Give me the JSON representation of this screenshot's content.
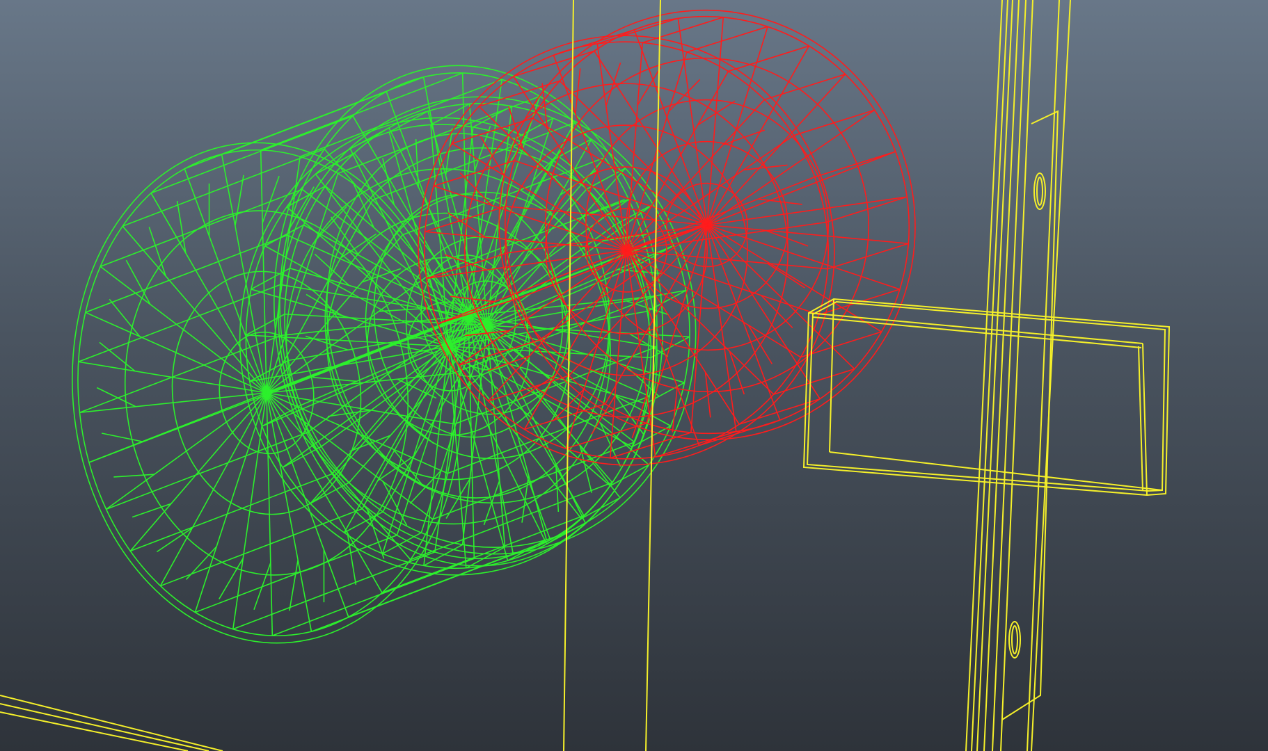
{
  "viewport": {
    "background_top": "#687788",
    "background_bottom": "#2e333a"
  },
  "colors": {
    "selected": "#2cf02c",
    "active": "#ff1c1c",
    "templated": "#f5f02a"
  },
  "objects": [
    {
      "name": "green-wheel-outer",
      "role": "selected",
      "shape": "cylinder-wireframe"
    },
    {
      "name": "green-wheel-inner",
      "role": "selected",
      "shape": "cylinder-wireframe"
    },
    {
      "name": "red-wheel",
      "role": "active",
      "shape": "cylinder-wireframe"
    },
    {
      "name": "yellow-axle-rod-left",
      "role": "templated",
      "shape": "line"
    },
    {
      "name": "yellow-axle-rod-right",
      "role": "templated",
      "shape": "line"
    },
    {
      "name": "yellow-frame-post",
      "role": "templated",
      "shape": "box-wireframe"
    },
    {
      "name": "yellow-crossbar-box",
      "role": "templated",
      "shape": "box-wireframe"
    },
    {
      "name": "yellow-floor-edge",
      "role": "templated",
      "shape": "line"
    }
  ]
}
